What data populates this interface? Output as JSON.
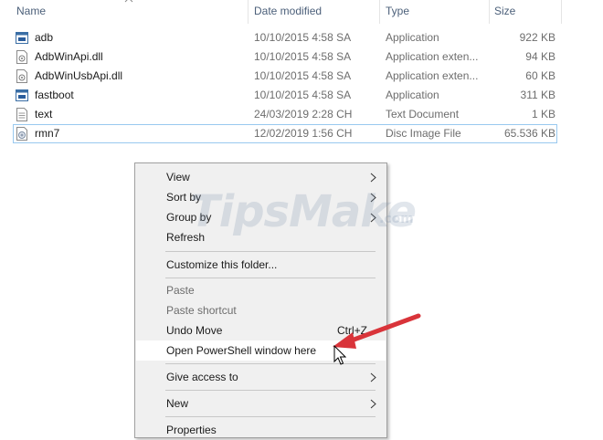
{
  "columns": {
    "name": "Name",
    "date": "Date modified",
    "type": "Type",
    "size": "Size"
  },
  "files": [
    {
      "name": "adb",
      "date": "10/10/2015 4:58 SA",
      "type": "Application",
      "size": "922 KB",
      "icon": "application-icon"
    },
    {
      "name": "AdbWinApi.dll",
      "date": "10/10/2015 4:58 SA",
      "type": "Application exten...",
      "size": "94 KB",
      "icon": "dll-icon"
    },
    {
      "name": "AdbWinUsbApi.dll",
      "date": "10/10/2015 4:58 SA",
      "type": "Application exten...",
      "size": "60 KB",
      "icon": "dll-icon"
    },
    {
      "name": "fastboot",
      "date": "10/10/2015 4:58 SA",
      "type": "Application",
      "size": "311 KB",
      "icon": "application-icon"
    },
    {
      "name": "text",
      "date": "24/03/2019 2:28 CH",
      "type": "Text Document",
      "size": "1 KB",
      "icon": "text-document-icon"
    },
    {
      "name": "rmn7",
      "date": "12/02/2019 1:56 CH",
      "type": "Disc Image File",
      "size": "65.536 KB",
      "icon": "disc-image-icon"
    }
  ],
  "context_menu": {
    "view": "View",
    "sort_by": "Sort by",
    "group_by": "Group by",
    "refresh": "Refresh",
    "customize": "Customize this folder...",
    "paste": "Paste",
    "paste_shortcut": "Paste shortcut",
    "undo_move": "Undo Move",
    "undo_shortcut": "Ctrl+Z",
    "open_powershell": "Open PowerShell window here",
    "give_access": "Give access to",
    "new": "New",
    "properties": "Properties"
  },
  "watermark": {
    "brand": "TipsMake",
    "domain": ".com"
  },
  "colors": {
    "menu_bg": "#f0f0f0",
    "highlight": "#ffffff",
    "arrow": "#d9343a",
    "header_text": "#4c607a"
  }
}
